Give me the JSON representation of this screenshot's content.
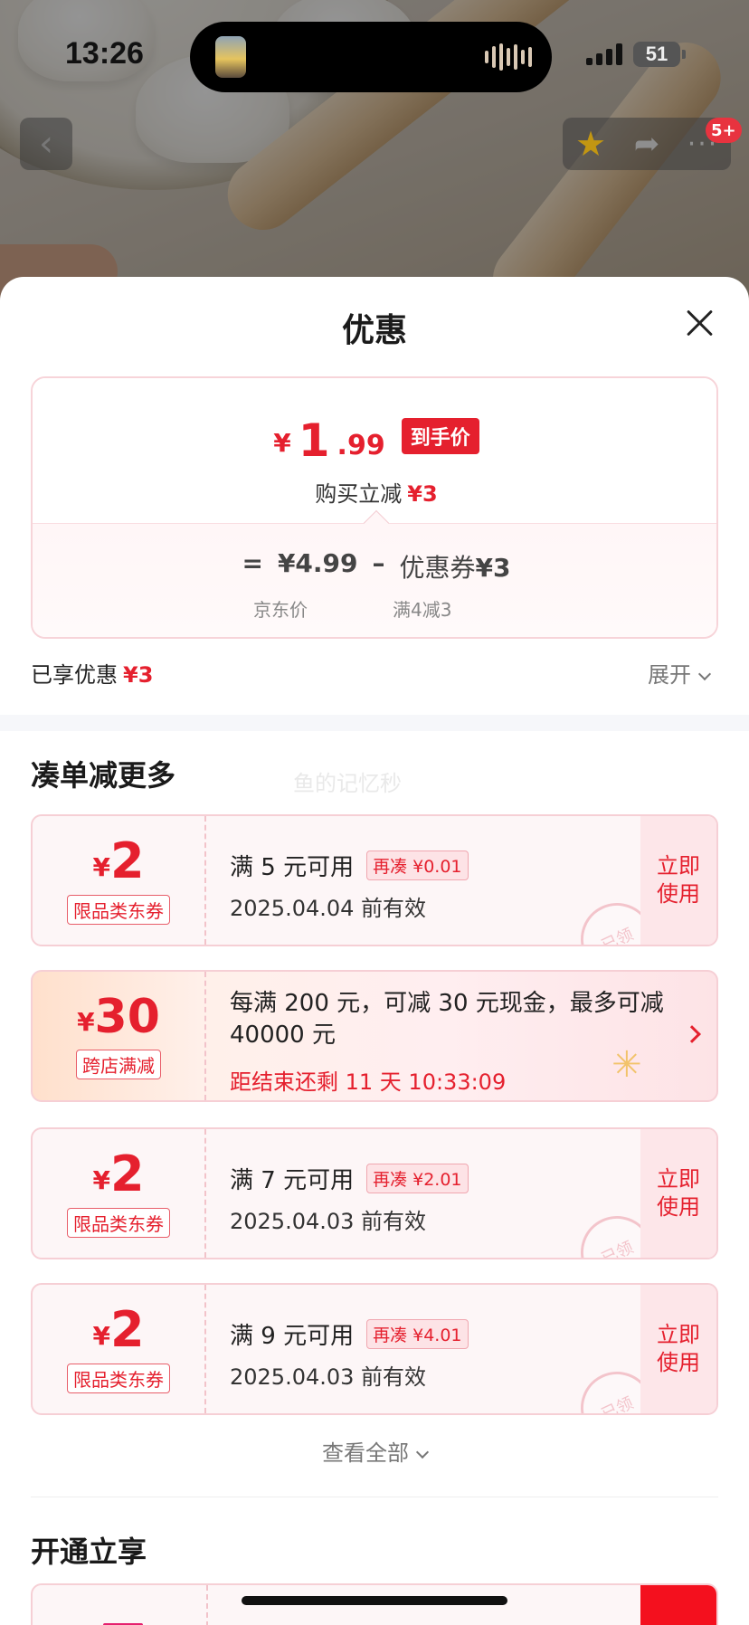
{
  "status_bar": {
    "time": "13:26",
    "battery": "51"
  },
  "nav": {
    "back_icon": "chevron-left-icon",
    "msg_badge": "5+"
  },
  "sheet": {
    "title": "优惠",
    "price": {
      "currency": "¥",
      "integer": "1",
      "decimal": ".99",
      "tag": "到手价",
      "reduce_label": "购买立减",
      "reduce_value": "¥3",
      "equals": "=",
      "jd_price": "¥4.99",
      "minus": "–",
      "coupon_label": "优惠券",
      "coupon_value": "¥3",
      "jd_price_label": "京东价",
      "coupon_rule": "满4减3"
    },
    "enjoyed_label": "已享优惠",
    "enjoyed_value": "¥3",
    "expand_label": "展开"
  },
  "more_section": {
    "title": "凑单减更多",
    "watermark": "鱼的记忆秒",
    "coupons": [
      {
        "symbol": "¥",
        "amount": "2",
        "tag": "限品类东券",
        "condition": "满 5 元可用",
        "diff": "再凑 ¥0.01",
        "valid": "2025.04.04 前有效",
        "action": "立即使用",
        "stamp": "已领"
      },
      {
        "symbol": "¥",
        "amount": "2",
        "tag": "限品类东券",
        "condition": "满 7 元可用",
        "diff": "再凑 ¥2.01",
        "valid": "2025.04.03 前有效",
        "action": "立即使用",
        "stamp": "已领"
      },
      {
        "symbol": "¥",
        "amount": "2",
        "tag": "限品类东券",
        "condition": "满 9 元可用",
        "diff": "再凑 ¥4.01",
        "valid": "2025.04.03 前有效",
        "action": "立即使用",
        "stamp": "已领"
      }
    ],
    "promo": {
      "symbol": "¥",
      "amount": "30",
      "tag": "跨店满减",
      "desc": "每满 200 元，可减 30 元现金，最多可减 40000 元",
      "countdown": "距结束还剩 11 天 10:33:09"
    },
    "see_all": "查看全部"
  },
  "member_section": {
    "title": "开通立享"
  },
  "colors": {
    "accent_red": "#e5202e",
    "card_border": "#f6cfd5",
    "card_bg": "#fdf6f7"
  }
}
